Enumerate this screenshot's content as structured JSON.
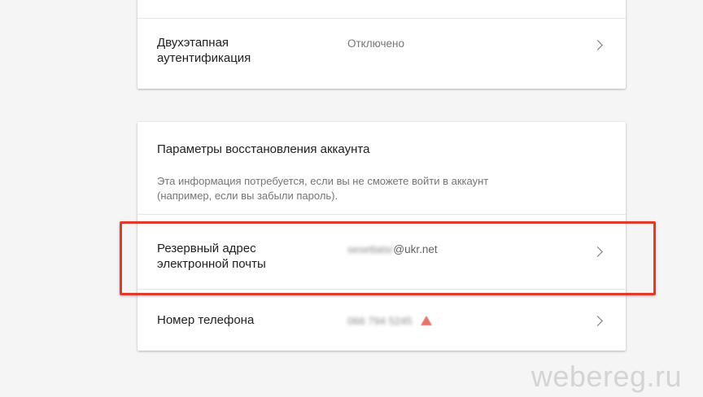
{
  "two_step": {
    "label_line1": "Двухэтапная",
    "label_line2": "аутентификация",
    "status": "Отключено"
  },
  "recovery": {
    "title": "Параметры восстановления аккаунта",
    "description_line1": "Эта информация потребуется, если вы не сможете войти в аккаунт",
    "description_line2": "(например, если вы забыли пароль).",
    "email_row": {
      "label_line1": "Резервный адрес",
      "label_line2": "электронной почты",
      "value_hidden": "sesettatsr",
      "value_domain": "@ukr.net"
    },
    "phone_row": {
      "label": "Номер телефона",
      "value_hidden": "066 794 5245",
      "warning_icon": "warning-icon"
    }
  },
  "highlight_color": "#e23a2a",
  "watermark": "webereg.ru"
}
